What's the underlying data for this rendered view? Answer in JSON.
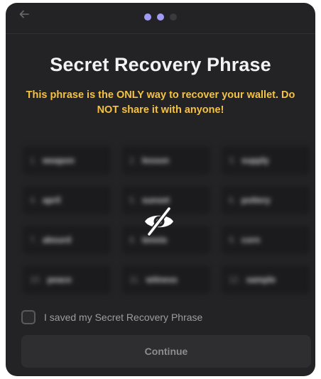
{
  "nav": {
    "back_icon": "arrow-left-icon",
    "steps": [
      {
        "state": "active"
      },
      {
        "state": "active"
      },
      {
        "state": "inactive"
      }
    ]
  },
  "title": "Secret Recovery Phrase",
  "warning": "This phrase is the ONLY way to recover your wallet. Do NOT share it with anyone!",
  "phrase": [
    {
      "num": "1.",
      "word": "weapon"
    },
    {
      "num": "2.",
      "word": "lesson"
    },
    {
      "num": "3.",
      "word": "supply"
    },
    {
      "num": "4.",
      "word": "april"
    },
    {
      "num": "5.",
      "word": "sunset"
    },
    {
      "num": "6.",
      "word": "pottery"
    },
    {
      "num": "7.",
      "word": "absurd"
    },
    {
      "num": "8.",
      "word": "tennis"
    },
    {
      "num": "9.",
      "word": "corn"
    },
    {
      "num": "10.",
      "word": "peace"
    },
    {
      "num": "11.",
      "word": "witness"
    },
    {
      "num": "12.",
      "word": "sample"
    }
  ],
  "reveal_icon": "eye-slash-icon",
  "checkbox_label": "I saved my Secret Recovery Phrase",
  "checkbox_checked": false,
  "continue_label": "Continue",
  "colors": {
    "background": "#232325",
    "accent": "#a29bf5",
    "warning": "#f5c242"
  }
}
